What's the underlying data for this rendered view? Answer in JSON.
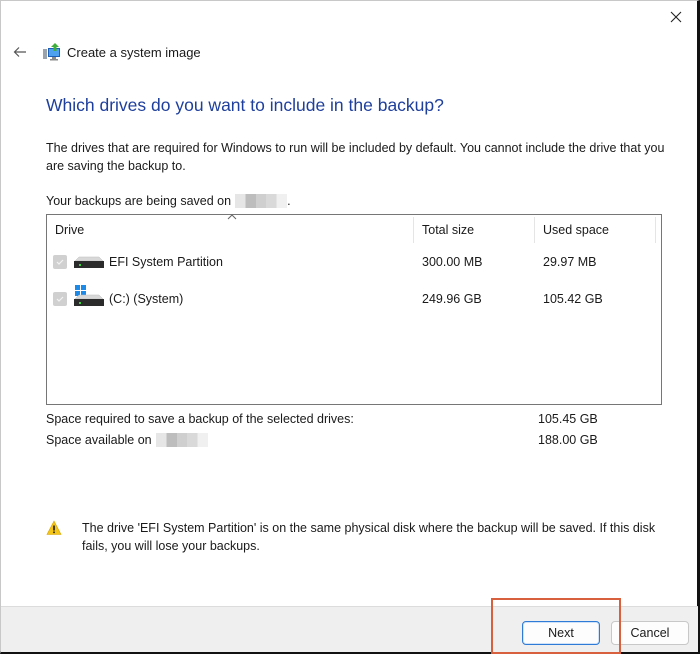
{
  "window": {
    "title": "Create a system image",
    "close_label": "Close"
  },
  "page": {
    "heading": "Which drives do you want to include in the backup?",
    "description": "The drives that are required for Windows to run will be included by default. You cannot include the drive that you are saving the backup to.",
    "saved_on_label": "Your backups are being saved on",
    "saved_on_value_redacted": true
  },
  "drive_list": {
    "columns": [
      "Drive",
      "Total size",
      "Used space"
    ],
    "sort_column": "Drive",
    "rows": [
      {
        "name": "EFI System Partition",
        "total_size": "300.00 MB",
        "used_space": "29.97 MB",
        "checked": true,
        "disabled": true,
        "icon": "hard-drive-icon"
      },
      {
        "name": "(C:) (System)",
        "total_size": "249.96 GB",
        "used_space": "105.42 GB",
        "checked": true,
        "disabled": true,
        "icon": "windows-drive-icon"
      }
    ]
  },
  "summary": {
    "required_label": "Space required to save a backup of the selected drives:",
    "required_value": "105.45 GB",
    "available_label": "Space available on",
    "available_value": "188.00 GB"
  },
  "warning": {
    "icon": "warning-icon",
    "text": "The drive 'EFI System Partition' is on the same physical disk where the backup will be saved. If this disk fails, you will lose your backups."
  },
  "footer": {
    "next_label": "Next",
    "cancel_label": "Cancel"
  },
  "colors": {
    "heading": "#1e3f9c",
    "highlight": "#d9603f",
    "primary_border": "#2d7bd6"
  }
}
